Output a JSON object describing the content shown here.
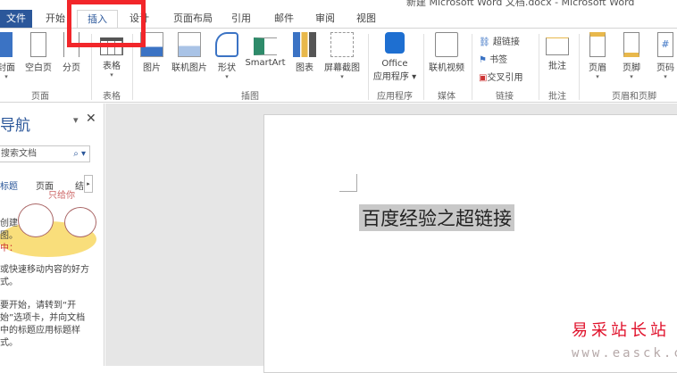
{
  "window": {
    "title": "新建 Microsoft Word 文档.docx - Microsoft Word"
  },
  "tabs": [
    "文件",
    "开始",
    "插入",
    "设计",
    "页面布局",
    "引用",
    "邮件",
    "审阅",
    "视图"
  ],
  "ribbon": {
    "pages": {
      "items": [
        "封面",
        "空白页",
        "分页"
      ],
      "label": "页面"
    },
    "tables": {
      "items": [
        "表格"
      ],
      "label": "表格"
    },
    "illustrations": {
      "items": [
        "图片",
        "联机图片",
        "形状",
        "SmartArt",
        "图表",
        "屏幕截图"
      ],
      "label": "插图"
    },
    "apps": {
      "line1": "Office",
      "line2": "应用程序",
      "label": "应用程序"
    },
    "media": {
      "items": [
        "联机视频"
      ],
      "label": "媒体"
    },
    "links": {
      "items": [
        "超链接",
        "书签",
        "交叉引用"
      ],
      "label": "链接"
    },
    "comments": {
      "items": [
        "批注"
      ],
      "label": "批注"
    },
    "headerfooter": {
      "items": [
        "页眉",
        "页脚",
        "页码"
      ],
      "label": "页眉和页脚"
    }
  },
  "nav": {
    "title": "导航",
    "search_placeholder": "搜索文档",
    "tabs": [
      "标题",
      "页面",
      "结"
    ],
    "text": [
      "创建",
      "图。",
      "中：",
      "或快速移动内容的好方",
      "式。",
      "要开始，请转到“开",
      "始”选项卡，并向文档",
      "中的标题应用标题样",
      "式。"
    ],
    "sticker_text": "只给你"
  },
  "document": {
    "selected_text": "百度经验之超链接"
  },
  "watermark": {
    "name": "易采站长站",
    "url": "www.easck.com"
  }
}
